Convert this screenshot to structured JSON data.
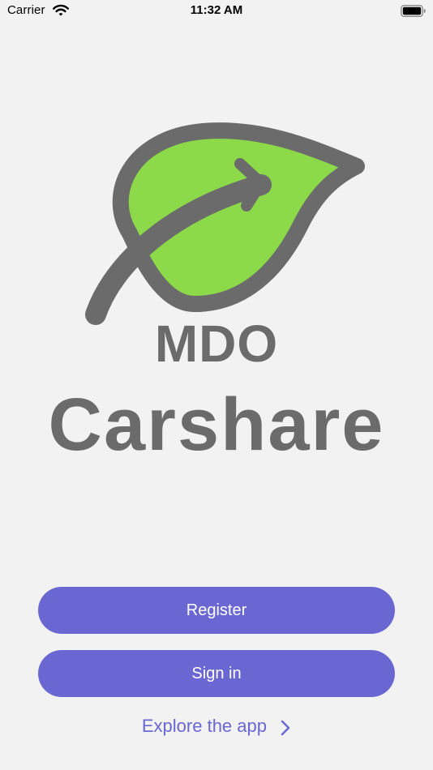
{
  "status_bar": {
    "carrier": "Carrier",
    "time": "11:32 AM"
  },
  "logo": {
    "line1": "MDO",
    "line2": "Carshare",
    "leaf_color": "#8cd94a",
    "outline_color": "#6b6b6b",
    "icon": "leaf-arrow-icon"
  },
  "actions": {
    "register_label": "Register",
    "signin_label": "Sign in",
    "explore_label": "Explore the app"
  },
  "colors": {
    "accent": "#6a67d2",
    "background": "#f2f2f2",
    "text_gray": "#6b6b6b"
  }
}
